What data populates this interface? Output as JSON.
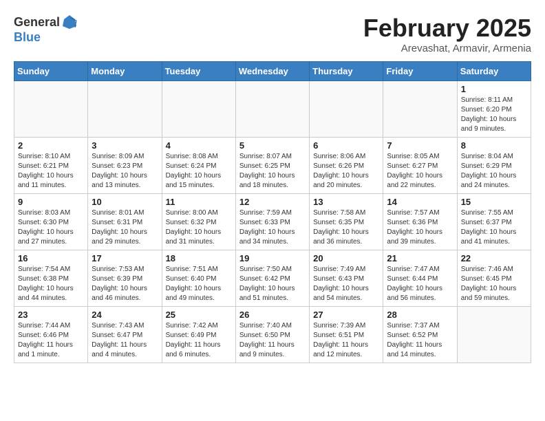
{
  "header": {
    "logo_general": "General",
    "logo_blue": "Blue",
    "month_title": "February 2025",
    "location": "Arevashat, Armavir, Armenia"
  },
  "days_of_week": [
    "Sunday",
    "Monday",
    "Tuesday",
    "Wednesday",
    "Thursday",
    "Friday",
    "Saturday"
  ],
  "weeks": [
    [
      {
        "day": "",
        "info": ""
      },
      {
        "day": "",
        "info": ""
      },
      {
        "day": "",
        "info": ""
      },
      {
        "day": "",
        "info": ""
      },
      {
        "day": "",
        "info": ""
      },
      {
        "day": "",
        "info": ""
      },
      {
        "day": "1",
        "info": "Sunrise: 8:11 AM\nSunset: 6:20 PM\nDaylight: 10 hours and 9 minutes."
      }
    ],
    [
      {
        "day": "2",
        "info": "Sunrise: 8:10 AM\nSunset: 6:21 PM\nDaylight: 10 hours and 11 minutes."
      },
      {
        "day": "3",
        "info": "Sunrise: 8:09 AM\nSunset: 6:23 PM\nDaylight: 10 hours and 13 minutes."
      },
      {
        "day": "4",
        "info": "Sunrise: 8:08 AM\nSunset: 6:24 PM\nDaylight: 10 hours and 15 minutes."
      },
      {
        "day": "5",
        "info": "Sunrise: 8:07 AM\nSunset: 6:25 PM\nDaylight: 10 hours and 18 minutes."
      },
      {
        "day": "6",
        "info": "Sunrise: 8:06 AM\nSunset: 6:26 PM\nDaylight: 10 hours and 20 minutes."
      },
      {
        "day": "7",
        "info": "Sunrise: 8:05 AM\nSunset: 6:27 PM\nDaylight: 10 hours and 22 minutes."
      },
      {
        "day": "8",
        "info": "Sunrise: 8:04 AM\nSunset: 6:29 PM\nDaylight: 10 hours and 24 minutes."
      }
    ],
    [
      {
        "day": "9",
        "info": "Sunrise: 8:03 AM\nSunset: 6:30 PM\nDaylight: 10 hours and 27 minutes."
      },
      {
        "day": "10",
        "info": "Sunrise: 8:01 AM\nSunset: 6:31 PM\nDaylight: 10 hours and 29 minutes."
      },
      {
        "day": "11",
        "info": "Sunrise: 8:00 AM\nSunset: 6:32 PM\nDaylight: 10 hours and 31 minutes."
      },
      {
        "day": "12",
        "info": "Sunrise: 7:59 AM\nSunset: 6:33 PM\nDaylight: 10 hours and 34 minutes."
      },
      {
        "day": "13",
        "info": "Sunrise: 7:58 AM\nSunset: 6:35 PM\nDaylight: 10 hours and 36 minutes."
      },
      {
        "day": "14",
        "info": "Sunrise: 7:57 AM\nSunset: 6:36 PM\nDaylight: 10 hours and 39 minutes."
      },
      {
        "day": "15",
        "info": "Sunrise: 7:55 AM\nSunset: 6:37 PM\nDaylight: 10 hours and 41 minutes."
      }
    ],
    [
      {
        "day": "16",
        "info": "Sunrise: 7:54 AM\nSunset: 6:38 PM\nDaylight: 10 hours and 44 minutes."
      },
      {
        "day": "17",
        "info": "Sunrise: 7:53 AM\nSunset: 6:39 PM\nDaylight: 10 hours and 46 minutes."
      },
      {
        "day": "18",
        "info": "Sunrise: 7:51 AM\nSunset: 6:40 PM\nDaylight: 10 hours and 49 minutes."
      },
      {
        "day": "19",
        "info": "Sunrise: 7:50 AM\nSunset: 6:42 PM\nDaylight: 10 hours and 51 minutes."
      },
      {
        "day": "20",
        "info": "Sunrise: 7:49 AM\nSunset: 6:43 PM\nDaylight: 10 hours and 54 minutes."
      },
      {
        "day": "21",
        "info": "Sunrise: 7:47 AM\nSunset: 6:44 PM\nDaylight: 10 hours and 56 minutes."
      },
      {
        "day": "22",
        "info": "Sunrise: 7:46 AM\nSunset: 6:45 PM\nDaylight: 10 hours and 59 minutes."
      }
    ],
    [
      {
        "day": "23",
        "info": "Sunrise: 7:44 AM\nSunset: 6:46 PM\nDaylight: 11 hours and 1 minute."
      },
      {
        "day": "24",
        "info": "Sunrise: 7:43 AM\nSunset: 6:47 PM\nDaylight: 11 hours and 4 minutes."
      },
      {
        "day": "25",
        "info": "Sunrise: 7:42 AM\nSunset: 6:49 PM\nDaylight: 11 hours and 6 minutes."
      },
      {
        "day": "26",
        "info": "Sunrise: 7:40 AM\nSunset: 6:50 PM\nDaylight: 11 hours and 9 minutes."
      },
      {
        "day": "27",
        "info": "Sunrise: 7:39 AM\nSunset: 6:51 PM\nDaylight: 11 hours and 12 minutes."
      },
      {
        "day": "28",
        "info": "Sunrise: 7:37 AM\nSunset: 6:52 PM\nDaylight: 11 hours and 14 minutes."
      },
      {
        "day": "",
        "info": ""
      }
    ]
  ]
}
